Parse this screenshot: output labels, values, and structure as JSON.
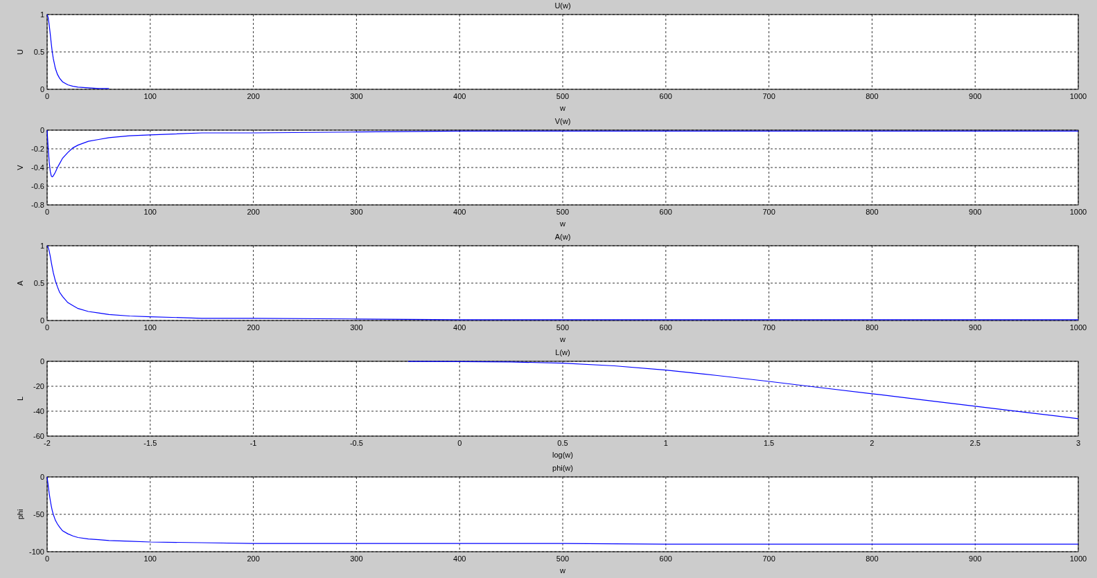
{
  "subplots": [
    {
      "chart_data": {
        "type": "line",
        "title": "U(w)",
        "xlabel": "w",
        "ylabel": "U",
        "grid": true,
        "x": [
          0,
          1,
          2,
          3,
          4,
          5,
          6,
          8,
          10,
          12,
          15,
          20,
          25,
          30,
          40,
          50,
          60
        ],
        "series": [
          {
            "color": "#0000ff",
            "values": [
              1,
              0.96,
              0.86,
              0.74,
              0.61,
              0.5,
              0.41,
              0.28,
              0.2,
              0.15,
              0.1,
              0.06,
              0.04,
              0.03,
              0.02,
              0.01,
              0.01
            ]
          }
        ],
        "xlim": [
          0,
          1000
        ],
        "ylim": [
          0,
          1
        ],
        "xticks": [
          0,
          100,
          200,
          300,
          400,
          500,
          600,
          700,
          800,
          900,
          1000
        ],
        "yticks": [
          0,
          0.5,
          1
        ]
      }
    },
    {
      "chart_data": {
        "type": "line",
        "title": "V(w)",
        "xlabel": "w",
        "ylabel": "V",
        "grid": true,
        "x": [
          0,
          1,
          2,
          3,
          4,
          5,
          6,
          8,
          10,
          12,
          15,
          20,
          25,
          30,
          40,
          50,
          60,
          80,
          100,
          150,
          200,
          300,
          400,
          500,
          600,
          700,
          800,
          900,
          1000
        ],
        "series": [
          {
            "color": "#0000ff",
            "values": [
              0,
              -0.19,
              -0.34,
              -0.44,
              -0.49,
              -0.5,
              -0.49,
              -0.45,
              -0.4,
              -0.36,
              -0.3,
              -0.24,
              -0.19,
              -0.16,
              -0.12,
              -0.1,
              -0.08,
              -0.06,
              -0.05,
              -0.03,
              -0.03,
              -0.02,
              -0.01,
              -0.01,
              -0.01,
              -0.01,
              -0.01,
              -0.01,
              -0.01
            ]
          }
        ],
        "xlim": [
          0,
          1000
        ],
        "ylim": [
          -0.8,
          0
        ],
        "xticks": [
          0,
          100,
          200,
          300,
          400,
          500,
          600,
          700,
          800,
          900,
          1000
        ],
        "yticks": [
          -0.8,
          -0.6,
          -0.4,
          -0.2,
          0
        ]
      }
    },
    {
      "chart_data": {
        "type": "line",
        "title": "A(w)",
        "xlabel": "w",
        "ylabel": "A",
        "grid": true,
        "x": [
          0,
          1,
          2,
          3,
          4,
          5,
          6,
          8,
          10,
          12,
          15,
          20,
          25,
          30,
          40,
          50,
          60,
          80,
          100,
          150,
          200,
          300,
          400,
          500,
          600,
          700,
          800,
          900,
          1000
        ],
        "series": [
          {
            "color": "#0000ff",
            "values": [
              1,
              0.98,
              0.93,
              0.86,
              0.78,
              0.71,
              0.64,
              0.53,
              0.45,
              0.38,
              0.32,
              0.24,
              0.2,
              0.16,
              0.12,
              0.1,
              0.08,
              0.06,
              0.05,
              0.03,
              0.03,
              0.02,
              0.01,
              0.01,
              0.01,
              0.01,
              0.01,
              0.01,
              0.01
            ]
          }
        ],
        "xlim": [
          0,
          1000
        ],
        "ylim": [
          0,
          1
        ],
        "xticks": [
          0,
          100,
          200,
          300,
          400,
          500,
          600,
          700,
          800,
          900,
          1000
        ],
        "yticks": [
          0,
          0.5,
          1
        ]
      }
    },
    {
      "chart_data": {
        "type": "line",
        "title": "L(w)",
        "xlabel": "log(w)",
        "ylabel": "L",
        "grid": true,
        "x": [
          -0.25,
          0,
          0.25,
          0.5,
          0.75,
          1,
          1.25,
          1.5,
          1.75,
          2,
          2.25,
          2.5,
          2.75,
          3
        ],
        "series": [
          {
            "color": "#0000ff",
            "values": [
              -0.1,
              -0.2,
              -0.5,
              -1.5,
              -3.6,
              -7,
              -11.4,
              -16.1,
              -21.1,
              -26,
              -31,
              -36,
              -41,
              -46
            ]
          }
        ],
        "xlim": [
          -2,
          3
        ],
        "ylim": [
          -60,
          0
        ],
        "xticks": [
          -2,
          -1.5,
          -1,
          -0.5,
          0,
          0.5,
          1,
          1.5,
          2,
          2.5,
          3
        ],
        "yticks": [
          -60,
          -40,
          -20,
          0
        ]
      }
    },
    {
      "chart_data": {
        "type": "line",
        "title": "phi(w)",
        "xlabel": "w",
        "ylabel": "phi",
        "grid": true,
        "x": [
          0,
          1,
          2,
          3,
          4,
          5,
          6,
          8,
          10,
          12,
          15,
          20,
          25,
          30,
          40,
          50,
          60,
          80,
          100,
          150,
          200,
          300,
          400,
          500,
          600,
          700,
          800,
          900,
          1000
        ],
        "series": [
          {
            "color": "#0000ff",
            "values": [
              0,
              -11,
              -22,
              -31,
              -39,
              -45,
              -50,
              -58,
              -63,
              -67,
              -72,
              -76,
              -79,
              -81,
              -83,
              -84,
              -85,
              -86,
              -87,
              -88,
              -89,
              -89,
              -89,
              -89,
              -90,
              -90,
              -90,
              -90,
              -90
            ]
          }
        ],
        "xlim": [
          0,
          1000
        ],
        "ylim": [
          -100,
          0
        ],
        "xticks": [
          0,
          100,
          200,
          300,
          400,
          500,
          600,
          700,
          800,
          900,
          1000
        ],
        "yticks": [
          -100,
          -50,
          0
        ]
      }
    }
  ]
}
